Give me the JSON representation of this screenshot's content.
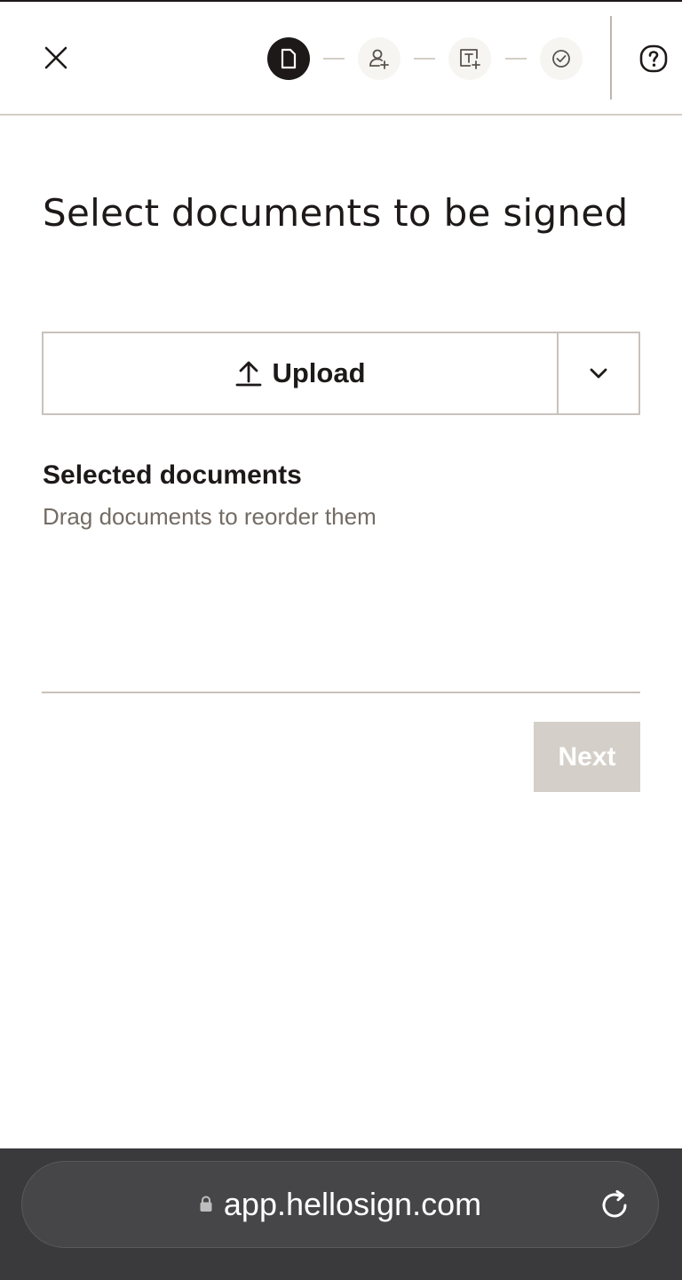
{
  "header": {
    "close_icon": "close-icon",
    "steps": [
      {
        "icon": "document-icon",
        "state": "active"
      },
      {
        "icon": "add-signer-icon",
        "state": "pending"
      },
      {
        "icon": "add-text-field-icon",
        "state": "pending"
      },
      {
        "icon": "check-circle-icon",
        "state": "pending"
      }
    ],
    "help_icon": "help-icon"
  },
  "main": {
    "title": "Select documents to be signed",
    "upload_label": "Upload",
    "selected_title": "Selected documents",
    "selected_subtitle": "Drag documents to reorder them",
    "next_label": "Next"
  },
  "browser": {
    "url": "app.hellosign.com"
  },
  "colors": {
    "text": "#1e1919",
    "muted": "#736c64",
    "border": "#c9c2bb",
    "disabled_button": "#d4cfc8",
    "browser_bar": "#3a3a3c"
  }
}
